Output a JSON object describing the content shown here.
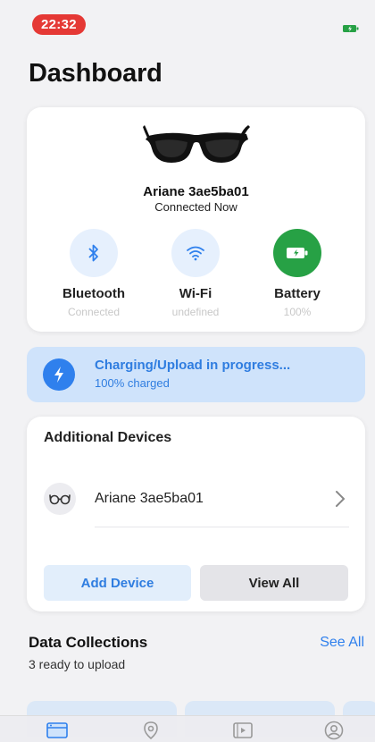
{
  "status_bar": {
    "time": "22:32"
  },
  "page": {
    "title": "Dashboard"
  },
  "device_card": {
    "name": "Ariane 3ae5ba01",
    "connection": "Connected Now",
    "stats": [
      {
        "label": "Bluetooth",
        "sub": "Connected",
        "icon": "bluetooth-icon"
      },
      {
        "label": "Wi-Fi",
        "sub": "undefined",
        "icon": "wifi-icon"
      },
      {
        "label": "Battery",
        "sub": "100%",
        "icon": "battery-icon"
      }
    ]
  },
  "charging": {
    "title": "Charging/Upload in progress...",
    "subtitle": "100% charged"
  },
  "additional_devices": {
    "title": "Additional Devices",
    "items": [
      {
        "label": "Ariane 3ae5ba01",
        "icon": "glasses-icon"
      }
    ],
    "add_label": "Add Device",
    "view_all_label": "View All"
  },
  "data_collections": {
    "title": "Data Collections",
    "subtitle": "3 ready to upload",
    "see_all_label": "See All"
  },
  "tabs": [
    {
      "icon": "dashboard-icon"
    },
    {
      "icon": "location-icon"
    },
    {
      "icon": "video-icon"
    },
    {
      "icon": "profile-icon"
    }
  ],
  "colors": {
    "accent": "#2f80ed",
    "battery_green": "#27a145",
    "time_pill": "#e53935",
    "banner_bg": "#cfe3fb"
  }
}
